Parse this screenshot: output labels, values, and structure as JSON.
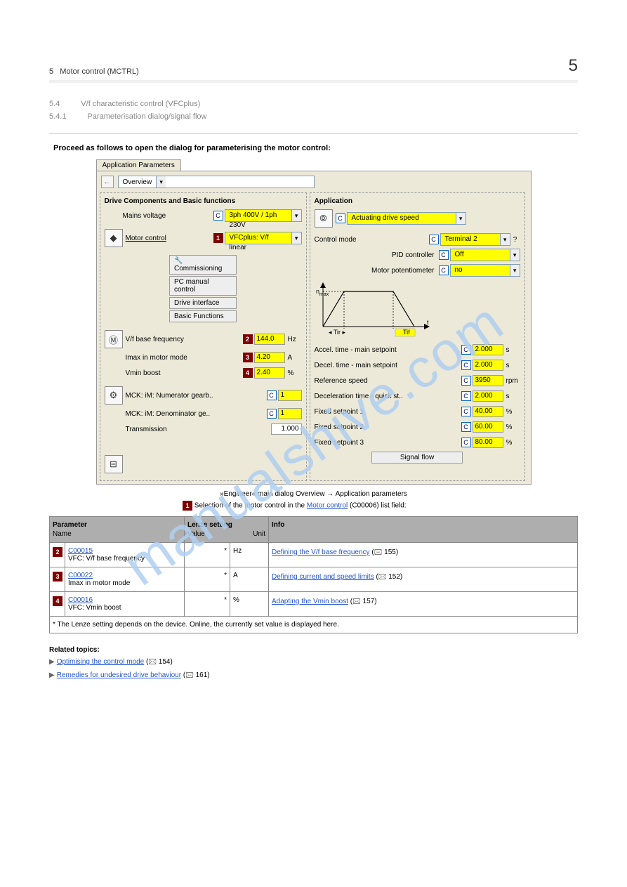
{
  "section": {
    "num": "5",
    "title": "Motor control (MCTRL)"
  },
  "subsec1": {
    "num": "5.4",
    "title": "V/f characteristic control (VFCplus)"
  },
  "subsec2": {
    "num": "5.4.1",
    "title": "Parameterisation dialog/signal flow"
  },
  "callout": "Proceed as follows to open the dialog for parameterising the motor control:",
  "screenshot": {
    "tabs": {
      "main": "Application Parameters"
    },
    "nav": {
      "selection": "Overview"
    },
    "left": {
      "group_title": "Drive Components and Basic functions",
      "mains_voltage_label": "Mains voltage",
      "mains_voltage_value": "3ph 400V / 1ph 230V",
      "motor_control_label": "Motor control",
      "motor_control_value": "VFCplus: V/f linear",
      "btn_commissioning": "Commissioning",
      "btn_pc_manual": "PC manual control",
      "btn_drive_interface": "Drive interface",
      "btn_basic_functions": "Basic Functions",
      "vf_base_label": "V/f base frequency",
      "vf_base_value": "144.0",
      "vf_base_unit": "Hz",
      "imax_label": "Imax in motor mode",
      "imax_value": "4.20",
      "imax_unit": "A",
      "vmin_label": "Vmin boost",
      "vmin_value": "2.40",
      "vmin_unit": "%",
      "mck_num_label": "MCK: iM: Numerator gearb..",
      "mck_num_value": "1",
      "mck_den_label": "MCK: iM: Denominator ge..",
      "mck_den_value": "1",
      "transmission_label": "Transmission",
      "transmission_value": "1.000",
      "badges": {
        "b1": "1",
        "b2": "2",
        "b3": "3",
        "b4": "4"
      }
    },
    "right": {
      "group_title": "Application",
      "app_value": "Actuating drive speed",
      "control_mode_label": "Control mode",
      "control_mode_value": "Terminal 2",
      "pid_label": "PID controller",
      "pid_value": "Off",
      "motor_pot_label": "Motor potentiometer",
      "motor_pot_value": "no",
      "accel_label": "Accel. time - main setpoint",
      "accel_value": "2.000",
      "accel_unit": "s",
      "decel_label": "Decel. time - main setpoint",
      "decel_value": "2.000",
      "decel_unit": "s",
      "ref_speed_label": "Reference speed",
      "ref_speed_value": "3950",
      "ref_speed_unit": "rpm",
      "qstop_label": "Deceleration time - quick st..",
      "qstop_value": "2.000",
      "qstop_unit": "s",
      "fsp1_label": "Fixed setpoint 1",
      "fsp1_value": "40.00",
      "fsp1_unit": "%",
      "fsp2_label": "Fixed setpoint 2",
      "fsp2_value": "60.00",
      "fsp2_unit": "%",
      "fsp3_label": "Fixed setpoint 3",
      "fsp3_value": "80.00",
      "fsp3_unit": "%",
      "signal_flow_btn": "Signal flow",
      "ramp_label_tir": "Tir",
      "ramp_label_tif": "Tif",
      "ramp_label_t": "t",
      "ramp_label_nmax": "nmax",
      "qmark": "?"
    }
  },
  "caption": {
    "idx": "1",
    "text": "»Engineer« main dialog Overview → Application parameters\nSelection of the motor control in the",
    "link_text": " Motor control",
    "link_page": " (C00006)",
    "list_field": " list field:"
  },
  "table": {
    "head_param": "Parameter",
    "head_name": "Name",
    "head_set": "Lenze setting",
    "head_val": "Value",
    "head_unit": "Unit",
    "head_info": "Info",
    "rows": [
      {
        "num": "2",
        "param": "C00015",
        "name": "VFC: V/f base frequency",
        "value": "*",
        "unit": "Hz",
        "info_link": "Defining the V/f base frequency",
        "info_page": "(🖂 155)"
      },
      {
        "num": "3",
        "param": "C00022",
        "name": "Imax in motor mode",
        "value": "*",
        "unit": "A",
        "info_link": "Defining current and speed limits",
        "info_page": "(🖂 152)"
      },
      {
        "num": "4",
        "param": "C00016",
        "name": "VFC: Vmin boost",
        "value": "*",
        "unit": "%",
        "info_link": "Adapting the Vmin boost",
        "info_page": "(🖂 157)"
      }
    ],
    "footnote": "*  The Lenze setting depends on the device. Online, the currently set value is displayed here."
  },
  "related": {
    "head": "Related topics:",
    "items": [
      {
        "label": "Optimising the control mode",
        "page": "(🖂 154)"
      },
      {
        "label": "Remedies for undesired drive behaviour",
        "page": "(🖂 161)"
      }
    ]
  }
}
